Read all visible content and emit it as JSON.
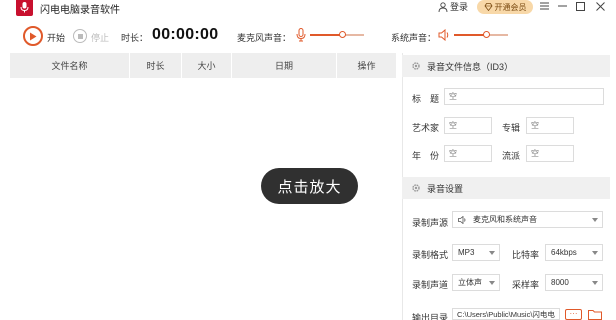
{
  "window": {
    "title": "闪电电脑录音软件",
    "login_label": "登录",
    "vip_label": "开通会员"
  },
  "toolbar": {
    "start_label": "开始",
    "stop_label": "停止",
    "duration_label": "时长：",
    "timer": "00:00:00",
    "mic_label": "麦克风声音：",
    "mic_volume_fraction": 0.6,
    "system_label": "系统声音：",
    "system_volume_fraction": 0.6
  },
  "table": {
    "columns": [
      "文件名称",
      "时长",
      "大小",
      "日期",
      "操作"
    ],
    "rows": []
  },
  "id3": {
    "section_title": "录音文件信息（ID3）",
    "title_label": "标　题",
    "artist_label": "艺术家",
    "album_label": "专辑",
    "year_label": "年　份",
    "genre_label": "流派",
    "empty_placeholder": "空"
  },
  "settings": {
    "section_title": "录音设置",
    "source_label": "录制声源",
    "source_value": "麦克风和系统声音",
    "format_label": "录制格式",
    "format_value": "MP3",
    "bitrate_label": "比特率",
    "bitrate_value": "64kbps",
    "channel_label": "录制声道",
    "channel_value": "立体声",
    "samplerate_label": "采样率",
    "samplerate_value": "8000",
    "output_label": "输出目录",
    "output_value": "C:\\Users\\Public\\Music\\闪电电",
    "browse_label": "···"
  },
  "overlay": {
    "zoom_label": "点击放大"
  },
  "colors": {
    "accent": "#e0592a",
    "brand_red": "#c8102e",
    "vip_bg": "#f8d8a8"
  }
}
